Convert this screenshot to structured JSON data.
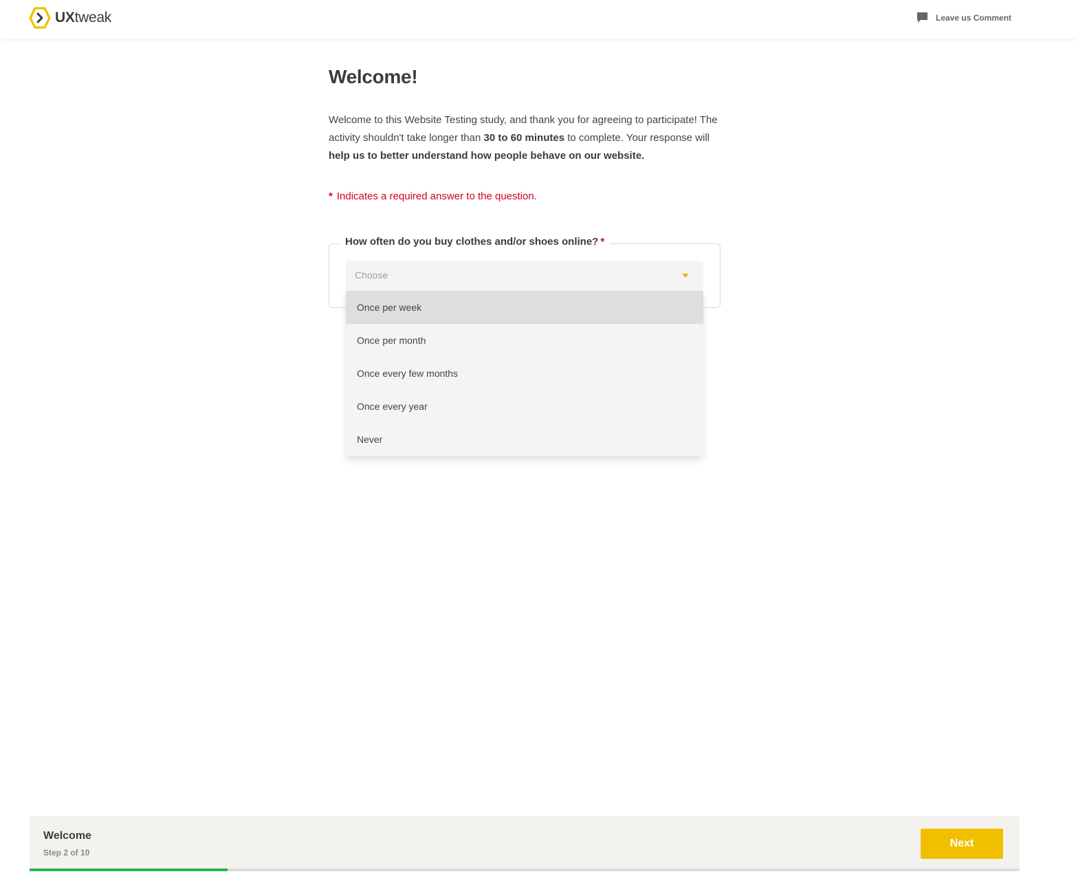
{
  "header": {
    "logo_bold": "UX",
    "logo_rest": "tweak",
    "comment_label": "Leave us Comment",
    "comment_icon": "speech-bubble-icon"
  },
  "main": {
    "title": "Welcome!",
    "intro": {
      "p1": "Welcome to this Website Testing study, and thank you for agreeing to participate! The activity shouldn't take longer than ",
      "b1": "30 to 60 minutes",
      "p2": " to complete. Your response will ",
      "b2": "help us to better understand how people behave on our website."
    },
    "required_star": "*",
    "required_note": "Indicates a required answer to the question."
  },
  "question": {
    "label": "How often do you buy clothes and/or shoes online?",
    "required_mark": "*",
    "placeholder": "Choose",
    "options": [
      "Once per week",
      "Once per month",
      "Once every few months",
      "Once every year",
      "Never"
    ],
    "highlighted_option": "Once per week"
  },
  "footer": {
    "step_title": "Welcome",
    "step_subtitle": "Step 2 of 10",
    "next_label": "Next",
    "progress_fraction": 0.2
  },
  "colors": {
    "brand_yellow": "#f0c000",
    "required_red": "#d0021b",
    "progress_green": "#2db34a"
  }
}
